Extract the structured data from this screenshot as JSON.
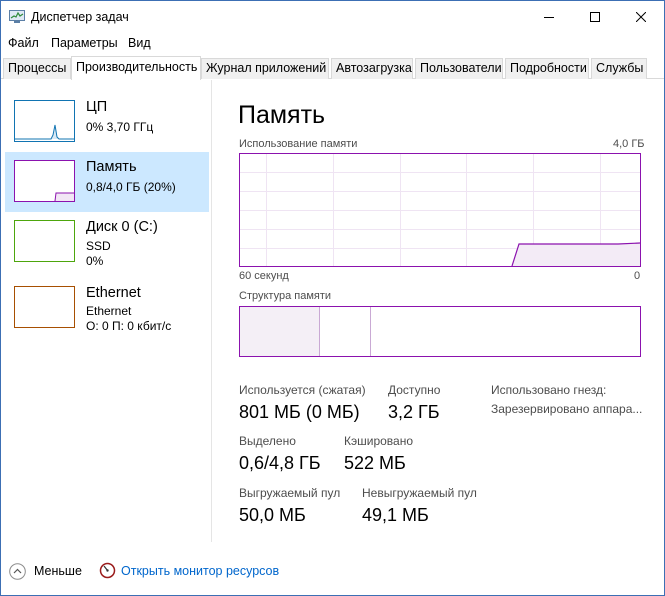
{
  "window": {
    "title": "Диспетчер задач",
    "app_icon": "task-manager-icon"
  },
  "menu": {
    "file": "Файл",
    "options": "Параметры",
    "view": "Вид"
  },
  "tabs": [
    {
      "label": "Процессы"
    },
    {
      "label": "Производительность",
      "active": true
    },
    {
      "label": "Журнал приложений"
    },
    {
      "label": "Автозагрузка"
    },
    {
      "label": "Пользователи"
    },
    {
      "label": "Подробности"
    },
    {
      "label": "Службы"
    }
  ],
  "sidebar": {
    "items": [
      {
        "name": "ЦП",
        "sub1": "0% 3,70 ГГц",
        "color": "#1174b2"
      },
      {
        "name": "Память",
        "sub1": "0,8/4,0 ГБ (20%)",
        "color": "#8b12ae",
        "selected": true
      },
      {
        "name": "Диск 0 (C:)",
        "sub1": "SSD",
        "sub2": "0%",
        "color": "#4da60c"
      },
      {
        "name": "Ethernet",
        "sub1": "Ethernet",
        "sub2": "О: 0 П: 0 кбит/с",
        "color": "#a74f01"
      }
    ]
  },
  "memory": {
    "title": "Память",
    "usage_label": "Использование памяти",
    "usage_max": "4,0 ГБ",
    "time_left": "60 секунд",
    "time_right": "0",
    "structure_label": "Структура памяти",
    "usage_fraction": 0.2,
    "accent_color": "#8b12ae",
    "stats": {
      "in_use_label": "Используется (сжатая)",
      "in_use_value": "801 МБ (0 МБ)",
      "available_label": "Доступно",
      "available_value": "3,2 ГБ",
      "slots_label": "Использовано гнезд:",
      "reserved_label": "Зарезервировано аппара...",
      "committed_label": "Выделено",
      "committed_value": "0,6/4,8 ГБ",
      "cached_label": "Кэшировано",
      "cached_value": "522 МБ",
      "paged_label": "Выгружаемый пул",
      "paged_value": "50,0 МБ",
      "nonpaged_label": "Невыгружаемый пул",
      "nonpaged_value": "49,1 МБ"
    }
  },
  "footer": {
    "less_label": "Меньше",
    "monitor_label": "Открыть монитор ресурсов"
  }
}
